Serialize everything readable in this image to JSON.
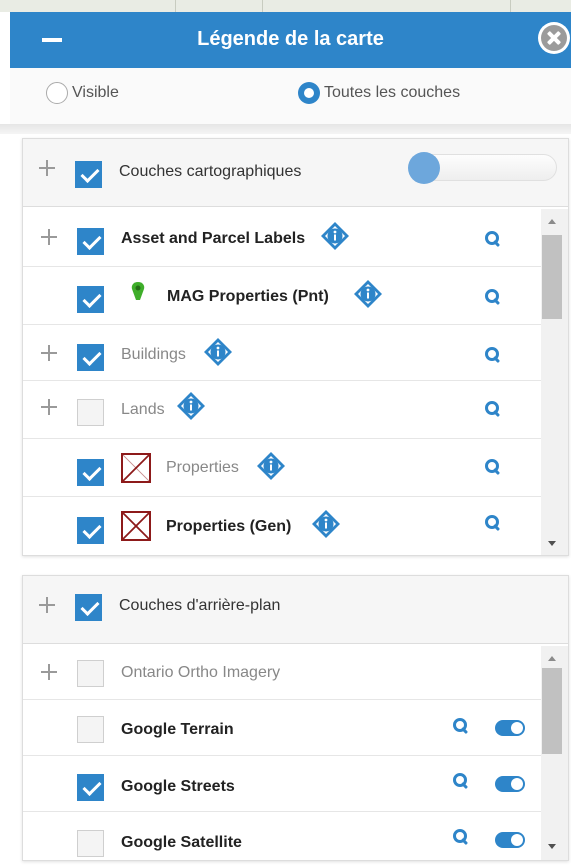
{
  "header": {
    "title": "Légende de la carte"
  },
  "radios": [
    {
      "label": "Visible",
      "selected": false
    },
    {
      "label": "Toutes les couches",
      "selected": true
    }
  ],
  "panel1": {
    "title": "Couches cartographiques",
    "checked": true,
    "opacity_level": 0,
    "layers": [
      {
        "name": "Asset and Parcel Labels",
        "checked": true,
        "expandable": true,
        "info": true,
        "style": "bold",
        "symbol": "none"
      },
      {
        "name": "MAG Properties (Pnt)",
        "checked": true,
        "expandable": false,
        "info": true,
        "style": "bold",
        "symbol": "green-pin-icon"
      },
      {
        "name": "Buildings",
        "checked": true,
        "expandable": true,
        "info": true,
        "style": "grey",
        "symbol": "none"
      },
      {
        "name": "Lands",
        "checked": false,
        "expandable": true,
        "info": true,
        "style": "grey",
        "symbol": "none"
      },
      {
        "name": "Properties",
        "checked": true,
        "expandable": false,
        "info": true,
        "style": "grey",
        "symbol": "red-crossed-box-icon"
      },
      {
        "name": "Properties (Gen)",
        "checked": true,
        "expandable": false,
        "info": true,
        "style": "bold",
        "symbol": "red-crossed-box-icon"
      }
    ]
  },
  "panel2": {
    "title": "Couches d'arrière-plan",
    "checked": true,
    "layers": [
      {
        "name": "Ontario Ortho Imagery",
        "checked": false,
        "expandable": true,
        "style": "grey",
        "toggle": false
      },
      {
        "name": "Google Terrain",
        "checked": false,
        "expandable": false,
        "style": "bold",
        "toggle": true
      },
      {
        "name": "Google Streets",
        "checked": true,
        "expandable": false,
        "style": "bold",
        "toggle": true
      },
      {
        "name": "Google Satellite",
        "checked": false,
        "expandable": false,
        "style": "bold",
        "toggle": true
      }
    ]
  },
  "colors": {
    "accent": "#2e85c9",
    "symbol_red": "#8d1a1a",
    "pin_green": "#3fae2a"
  }
}
